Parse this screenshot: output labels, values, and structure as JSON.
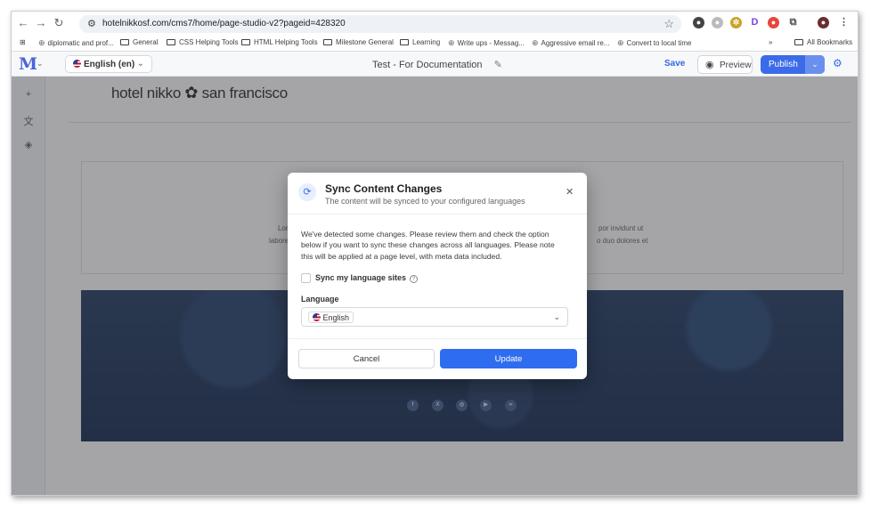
{
  "browser": {
    "url": "hotelnikkosf.com/cms7/home/page-studio-v2?pageid=428320",
    "bookmarks": [
      "diplomatic and prof...",
      "General",
      "CSS Helping Tools",
      "HTML Helping Tools",
      "Milestone General",
      "Learning",
      "Write ups - Messag...",
      "Aggressive email re...",
      "Convert to local time"
    ],
    "more_bookmarks": "»",
    "all_bookmarks": "All Bookmarks"
  },
  "app": {
    "logo": "M",
    "language_selector": "English (en)",
    "page_title": "Test - For Documentation",
    "save_label": "Save",
    "preview_label": "Preview",
    "publish_label": "Publish"
  },
  "canvas": {
    "hotel_logo_left": "hotel nikko",
    "hotel_logo_right": "san francisco",
    "lorem_left_1": "Lorem",
    "lorem_left_2": "labore e",
    "lorem_right_1": "por invidunt ut",
    "lorem_right_2": "o duo dolores et",
    "social_icons": [
      "facebook-icon",
      "x-icon",
      "instagram-icon",
      "youtube-icon",
      "tripadvisor-icon"
    ]
  },
  "modal": {
    "title": "Sync Content Changes",
    "subtitle": "The content will be synced to your configured languages",
    "body": "We've detected some changes. Please review them and check the option below if you want to sync these changes across all languages. Please note this will be applied at a page level, with meta data included.",
    "checkbox_label": "Sync my language sites",
    "checkbox_checked": false,
    "language_label": "Language",
    "language_selected": "English",
    "cancel_label": "Cancel",
    "update_label": "Update"
  },
  "colors": {
    "accent": "#2f6df0",
    "footer": "#243b60"
  }
}
